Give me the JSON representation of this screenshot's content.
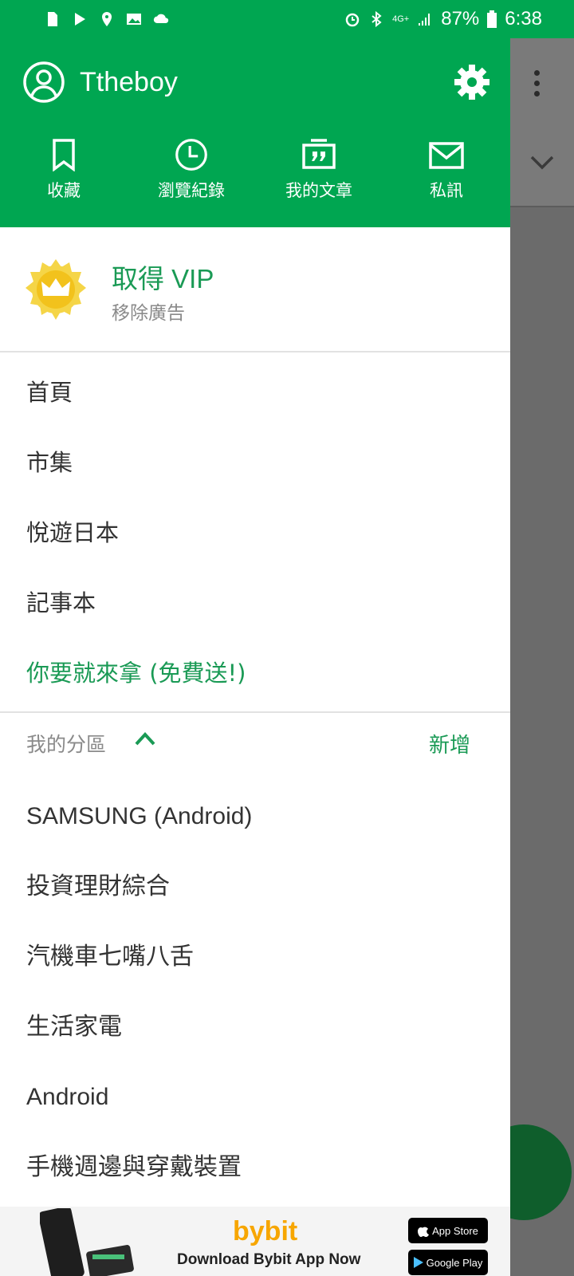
{
  "status_bar": {
    "battery": "87%",
    "time": "6:38",
    "network": "4G+"
  },
  "drawer": {
    "username": "Ttheboy",
    "shortcuts": [
      {
        "label": "收藏",
        "icon": "bookmark-icon"
      },
      {
        "label": "瀏覽紀錄",
        "icon": "clock-icon"
      },
      {
        "label": "我的文章",
        "icon": "quote-icon"
      },
      {
        "label": "私訊",
        "icon": "mail-icon"
      }
    ],
    "vip": {
      "title": "取得 VIP",
      "subtitle": "移除廣告"
    },
    "menu": [
      "首頁",
      "市集",
      "悅遊日本",
      "記事本"
    ],
    "promo_item": "你要就來拿 (免費送!)",
    "sections": {
      "title": "我的分區",
      "add_label": "新增",
      "items": [
        "SAMSUNG (Android)",
        "投資理財綜合",
        "汽機車七嘴八舌",
        "生活家電",
        "Android",
        "手機週邊與穿戴裝置"
      ]
    },
    "ad": {
      "brand": "bybit",
      "cta": "Download Bybit App Now",
      "app_store": "App Store",
      "google_play": "Google Play"
    }
  },
  "colors": {
    "brand_green": "#00a651",
    "text_green": "#1a9a55",
    "vip_gold": "#f5d547",
    "scrim": "#6b6b6b"
  }
}
